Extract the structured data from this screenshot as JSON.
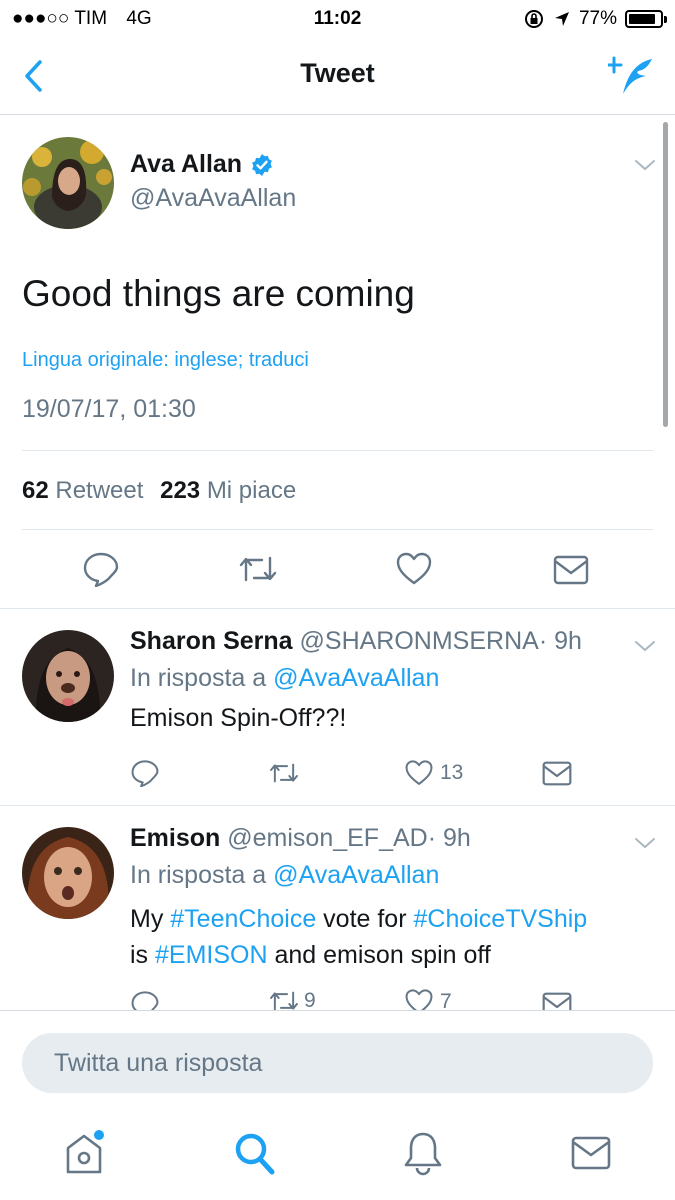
{
  "status_bar": {
    "carrier": "●●●○○ TIM",
    "network": "4G",
    "time": "11:02",
    "battery_pct": "77%"
  },
  "nav": {
    "title": "Tweet",
    "back_icon": "chevron-left-icon",
    "compose_icon": "compose-tweet-icon"
  },
  "main_tweet": {
    "author_name": "Ava Allan",
    "author_handle": "@AvaAvaAllan",
    "verified": true,
    "text": "Good things are coming",
    "translate_link": "Lingua originale: inglese; traduci",
    "timestamp": "19/07/17, 01:30",
    "retweets_count": "62",
    "retweets_label": "Retweet",
    "likes_count": "223",
    "likes_label": "Mi piace"
  },
  "replies": [
    {
      "name": "Sharon Serna",
      "handle": "@SHARONMSERNA",
      "time": "· 9h",
      "in_reply_prefix": "In risposta a",
      "in_reply_to": "@AvaAvaAllan",
      "text": "Emison Spin-Off??!",
      "reply_count": "",
      "retweet_count": "",
      "like_count": "13"
    },
    {
      "name": "Emison",
      "handle": "@emison_EF_AD",
      "time": "· 9h",
      "in_reply_prefix": "In risposta a",
      "in_reply_to": "@AvaAvaAllan",
      "text_parts": [
        "My ",
        "#TeenChoice",
        " vote for ",
        "#ChoiceTVShip",
        "is ",
        "#EMISON",
        " and emison spin off"
      ],
      "retweet_count": "9",
      "like_count": "7"
    }
  ],
  "reply_box": {
    "placeholder": "Twitta una risposta"
  },
  "tab_bar": {
    "items": [
      "home-icon",
      "search-icon",
      "notifications-bell-icon",
      "messages-envelope-icon"
    ]
  },
  "colors": {
    "accent": "#1da1f2",
    "secondary_text": "#657786",
    "divider": "#e1e8ed",
    "input_bg": "#e6ecf0"
  }
}
